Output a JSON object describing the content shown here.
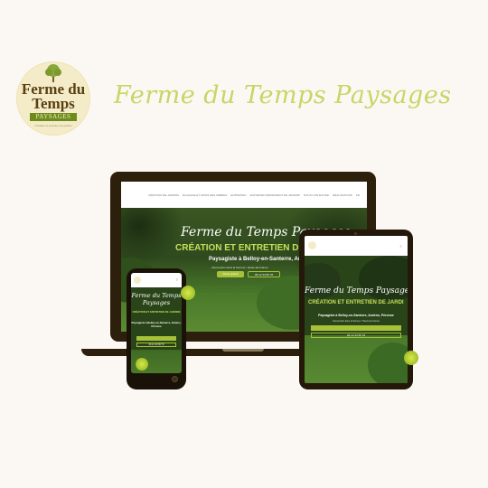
{
  "logo": {
    "line1": "Ferme du",
    "line2": "Temps",
    "tag": "PAYSAGES",
    "small": "Création et entretien de jardins"
  },
  "headline": "Ferme du Temps Paysages",
  "laptop": {
    "nav_items": [
      "CRÉATION DE JARDINS",
      "ÉLAGAGE ET SOINS DES ARBRES",
      "ENTRETIEN",
      "ENTRETIEN PERMANENT DE JARDINS",
      "NOUS CONTACTER",
      "RÉALISATIONS",
      "FR"
    ],
    "title": "Ferme du Temps Paysages",
    "subtitle": "CRÉATION ET ENTRETIEN DE JARDI",
    "location": "Paysagiste à Belloy-en-Santerre, Amiens, Péron",
    "small": "Intervention dans la Somme / Hauts-de-France",
    "btn_primary": "Devis gratuit",
    "btn_phone": "06 12 34 56 78"
  },
  "tablet": {
    "title": "Ferme du Temps Paysages",
    "subtitle": "CRÉATION ET ENTRETIEN DE JARDI",
    "location": "Paysagiste à Belloy-en-Santerre, Amiens, Péronne",
    "small": "Intervention dans la Somme / Hauts-de-France",
    "bar_primary": "",
    "bar_phone": "06 12 34 56 78"
  },
  "phone": {
    "title": "Ferme du Temps Paysages",
    "subtitle": "CRÉATION ET ENTRETIEN DE JARDINS",
    "location": "Paysagiste à Belloy-en-Santerre, Amiens, Péronne",
    "bar_primary": "",
    "bar_phone": "06 12 34 56 78"
  },
  "colors": {
    "accent_green": "#a7c239",
    "headline_yellow": "#cad467",
    "device_frame": "#2c1f0c",
    "background": "#fbf8f3"
  }
}
